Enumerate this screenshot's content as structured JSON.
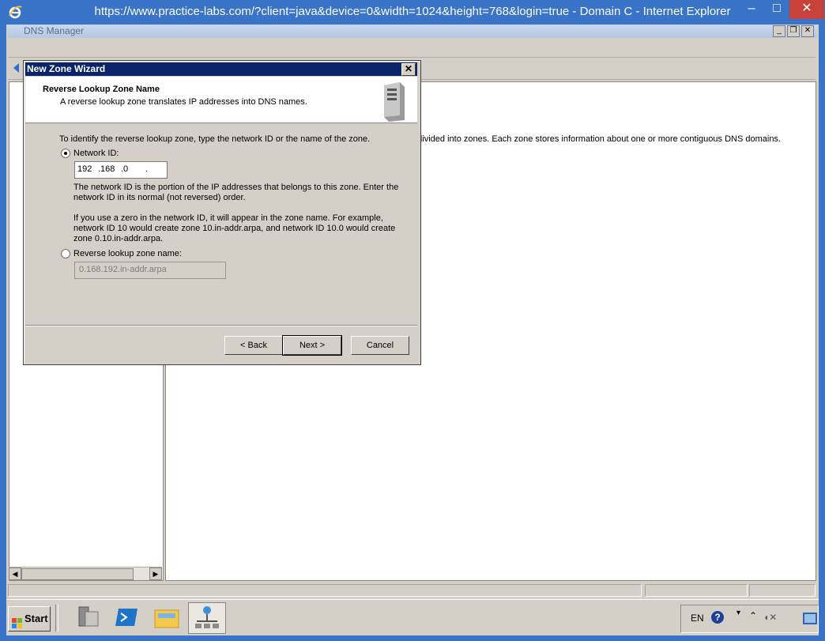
{
  "browser": {
    "title": "https://www.practice-labs.com/?client=java&device=0&width=1024&height=768&login=true - Domain C - Internet Explorer",
    "min": "–",
    "max": "□",
    "close": "✕"
  },
  "dns_manager": {
    "title": "DNS Manager",
    "controls": {
      "min": "_",
      "restore": "❐",
      "close": "✕"
    },
    "content_text": "e divided into zones. Each zone stores information about one or more contiguous DNS domains."
  },
  "wizard": {
    "title": "New Zone Wizard",
    "close": "✕",
    "header_title": "Reverse Lookup Zone Name",
    "header_subtitle": "A reverse lookup zone translates IP addresses into DNS names.",
    "intro": "To identify the reverse lookup zone, type the network ID or the name of the zone.",
    "network_id_label": "Network ID:",
    "network_id_octets": [
      "192",
      ".168",
      ".0",
      "."
    ],
    "network_id_desc": "The network ID is the portion of the IP addresses that belongs to this zone. Enter the network ID in its normal (not reversed) order.",
    "zero_desc": "If you use a zero in the network ID, it will appear in the zone name. For example, network ID 10 would create zone 10.in-addr.arpa, and network ID 10.0 would create zone 0.10.in-addr.arpa.",
    "reverse_label": "Reverse lookup zone name:",
    "reverse_value": "0.168.192.in-addr.arpa",
    "selected_option": "network_id",
    "buttons": {
      "back": "< Back",
      "next": "Next >",
      "cancel": "Cancel"
    }
  },
  "taskbar": {
    "start": "Start",
    "apps": [
      "server-manager",
      "powershell",
      "file-explorer",
      "dns-manager"
    ],
    "active_app": "dns-manager",
    "language": "EN",
    "help": "?"
  }
}
